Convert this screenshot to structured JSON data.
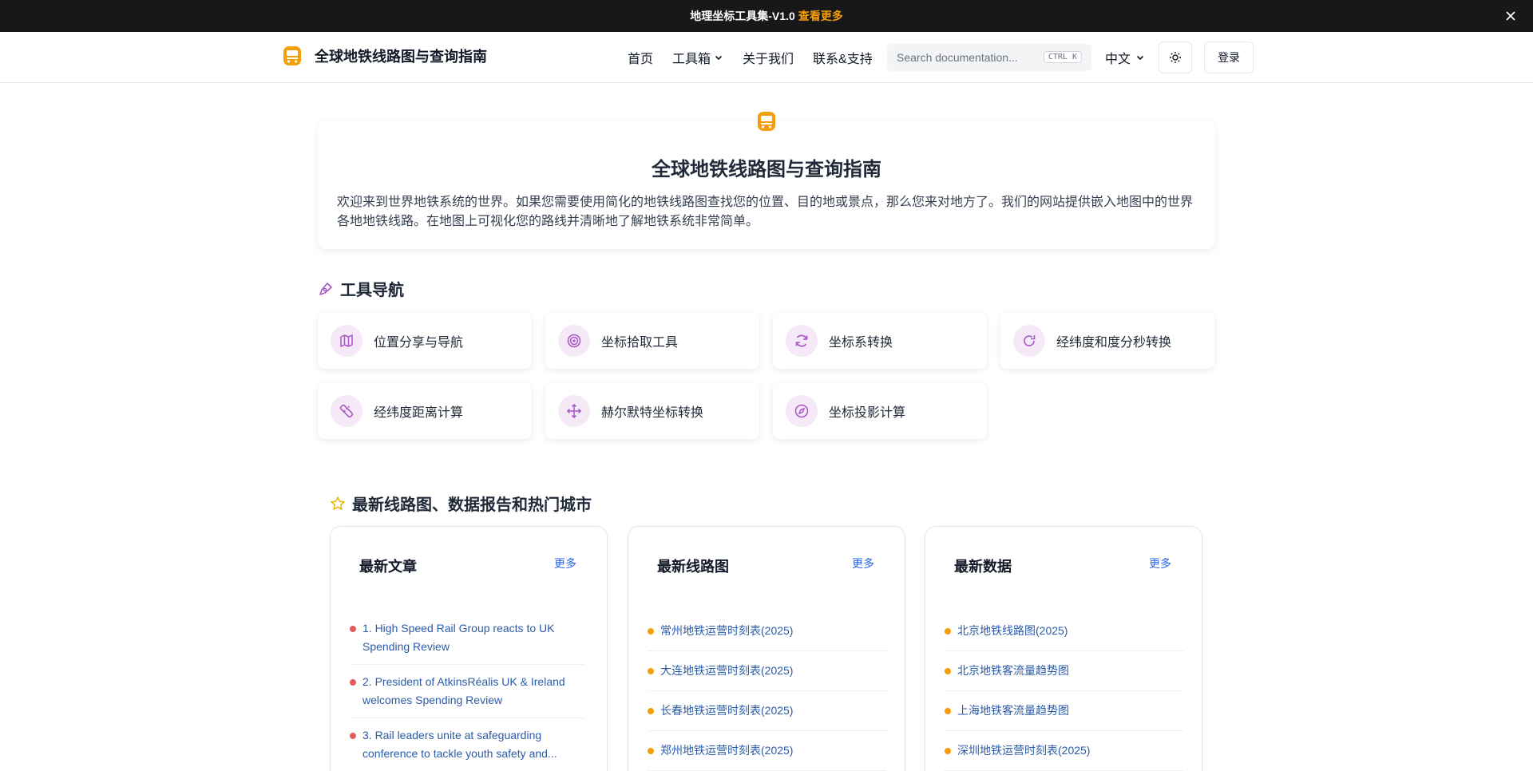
{
  "announcement": {
    "text": "地理坐标工具集-V1.0",
    "link": "查看更多"
  },
  "header": {
    "brand": "全球地铁线路图与查询指南",
    "nav": [
      "首页",
      "工具箱",
      "关于我们",
      "联系&支持"
    ],
    "search_placeholder": "Search documentation...",
    "search_kbd": "CTRL K",
    "lang": "中文",
    "login": "登录"
  },
  "hero": {
    "title": "全球地铁线路图与查询指南",
    "text": "欢迎来到世界地铁系统的世界。如果您需要使用简化的地铁线路图查找您的位置、目的地或景点，那么您来对地方了。我们的网站提供嵌入地图中的世界各地地铁线路。在地图上可视化您的路线并清晰地了解地铁系统非常简单。"
  },
  "tools": {
    "title": "工具导航",
    "items": [
      {
        "label": "位置分享与导航",
        "icon": "map-icon"
      },
      {
        "label": "坐标拾取工具",
        "icon": "target-icon"
      },
      {
        "label": "坐标系转换",
        "icon": "refresh-icon"
      },
      {
        "label": "经纬度和度分秒转换",
        "icon": "rotate-icon"
      },
      {
        "label": "经纬度距离计算",
        "icon": "ruler-icon"
      },
      {
        "label": "赫尔默特坐标转换",
        "icon": "move-icon"
      },
      {
        "label": "坐标投影计算",
        "icon": "compass-icon"
      }
    ]
  },
  "latest": {
    "title": "最新线路图、数据报告和热门城市",
    "columns": [
      {
        "title": "最新文章",
        "more": "更多",
        "items": [
          "1. High Speed Rail Group reacts to UK Spending Review",
          "2. President of AtkinsRéalis UK & Ireland welcomes Spending Review",
          "3. Rail leaders unite at safeguarding conference to tackle youth safety and..."
        ]
      },
      {
        "title": "最新线路图",
        "more": "更多",
        "items": [
          "常州地铁运营时刻表(2025)",
          "大连地铁运营时刻表(2025)",
          "长春地铁运营时刻表(2025)",
          "郑州地铁运营时刻表(2025)"
        ]
      },
      {
        "title": "最新数据",
        "more": "更多",
        "items": [
          "北京地铁线路图(2025)",
          "北京地铁客流量趋势图",
          "上海地铁客流量趋势图",
          "深圳地铁运营时刻表(2025)"
        ]
      }
    ]
  },
  "colors": {
    "accent": "#f59e0b",
    "icon_bg": "#f5e8f7",
    "icon_fg": "#a855c7",
    "link": "#2b5ba8"
  }
}
